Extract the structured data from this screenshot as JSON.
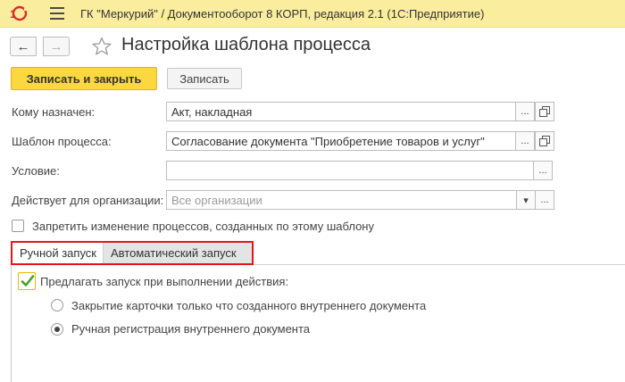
{
  "window": {
    "title": "ГК \"Меркурий\" / Документооборот 8 КОРП, редакция 2.1  (1С:Предприятие)",
    "logo": "1С"
  },
  "nav": {
    "back_icon": "←",
    "forward_icon": "→"
  },
  "page": {
    "title": "Настройка шаблона процесса"
  },
  "toolbar": {
    "save_close_label": "Записать и закрыть",
    "save_label": "Записать"
  },
  "form": {
    "assigned_to": {
      "label": "Кому назначен:",
      "value": "Акт, накладная"
    },
    "process_template": {
      "label": "Шаблон процесса:",
      "value": "Согласование документа \"Приобретение товаров и услуг\""
    },
    "condition": {
      "label": "Условие:",
      "value": ""
    },
    "organization": {
      "label": "Действует для организации:",
      "placeholder": "Все организации"
    },
    "forbid_changes": {
      "label": "Запретить изменение процессов, созданных по этому шаблону",
      "checked": false
    },
    "select_button": "...",
    "dropdown_icon": "▾"
  },
  "tabs": [
    {
      "label": "Ручной запуск",
      "active": true
    },
    {
      "label": "Автоматический запуск",
      "active": false
    }
  ],
  "manual_launch": {
    "offer_launch": {
      "label": "Предлагать запуск при выполнении действия:",
      "checked": true
    },
    "options": [
      {
        "label": "Закрытие карточки только что созданного внутреннего документа",
        "selected": false
      },
      {
        "label": "Ручная регистрация внутреннего документа",
        "selected": true
      }
    ]
  },
  "colors": {
    "titlebar": "#fbed9e",
    "primary_button": "#fbd83f",
    "highlight": "#e8141c",
    "logo_red": "#d62e2e"
  }
}
